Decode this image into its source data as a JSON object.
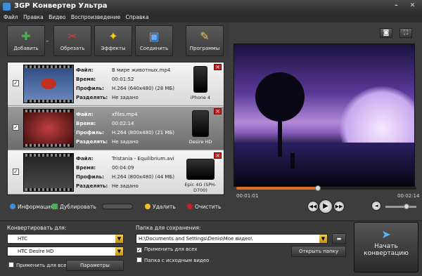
{
  "window": {
    "title": "3GP Конвертер Ультра",
    "minimize": "–",
    "close": "✕"
  },
  "menu": [
    "Файл",
    "Правка",
    "Видео",
    "Воспроизведение",
    "Справка"
  ],
  "toolbar": {
    "add": "Добавить",
    "cut": "Обрезать",
    "effects": "Эффекты",
    "join": "Соединить",
    "programs": "Программы"
  },
  "labels": {
    "file": "Файл:",
    "time": "Время:",
    "profile": "Профиль:",
    "split": "Разделять:"
  },
  "files": [
    {
      "checked": true,
      "name": "В мире животных.mp4",
      "time": "00:01:52",
      "profile": "H.264 (640x480) (28 МБ)",
      "split": "Не задано",
      "device": "iPhone 4"
    },
    {
      "checked": true,
      "name": "xfiles.mp4",
      "time": "00:02:14",
      "profile": "H.264 (800x480) (21 МБ)",
      "split": "Не задано",
      "device": "Desire HD"
    },
    {
      "checked": true,
      "name": "Tristania - Equilibrium.avi",
      "time": "00:04:09",
      "profile": "H.264 (800x480) (44 МБ)",
      "split": "Не задано",
      "device": "Epic 4G (SPH-D700)"
    }
  ],
  "listbar": {
    "info": "Информация",
    "duplicate": "Дублировать",
    "delete": "Удалить",
    "clear": "Очистить"
  },
  "player": {
    "current": "00:01:01",
    "total": "00:02:14",
    "progress": 0.46,
    "volume": 0.6
  },
  "convert": {
    "label": "Конвертировать для:",
    "brand": "HTC",
    "model": "HTC Desire HD",
    "apply_all": "Применить для всех",
    "params": "Параметры"
  },
  "output": {
    "label": "Папка для сохранения:",
    "path": "H:\\Documents and Settings\\Denis\\Мое видео\\",
    "apply_all": "Применить для всех",
    "source_folder": "Папка с исходным видео",
    "open": "Открыть папку"
  },
  "start": {
    "line1": "Начать",
    "line2": "конвертацию"
  },
  "colors": {
    "accent": "#e07020",
    "delete": "#c82020"
  }
}
